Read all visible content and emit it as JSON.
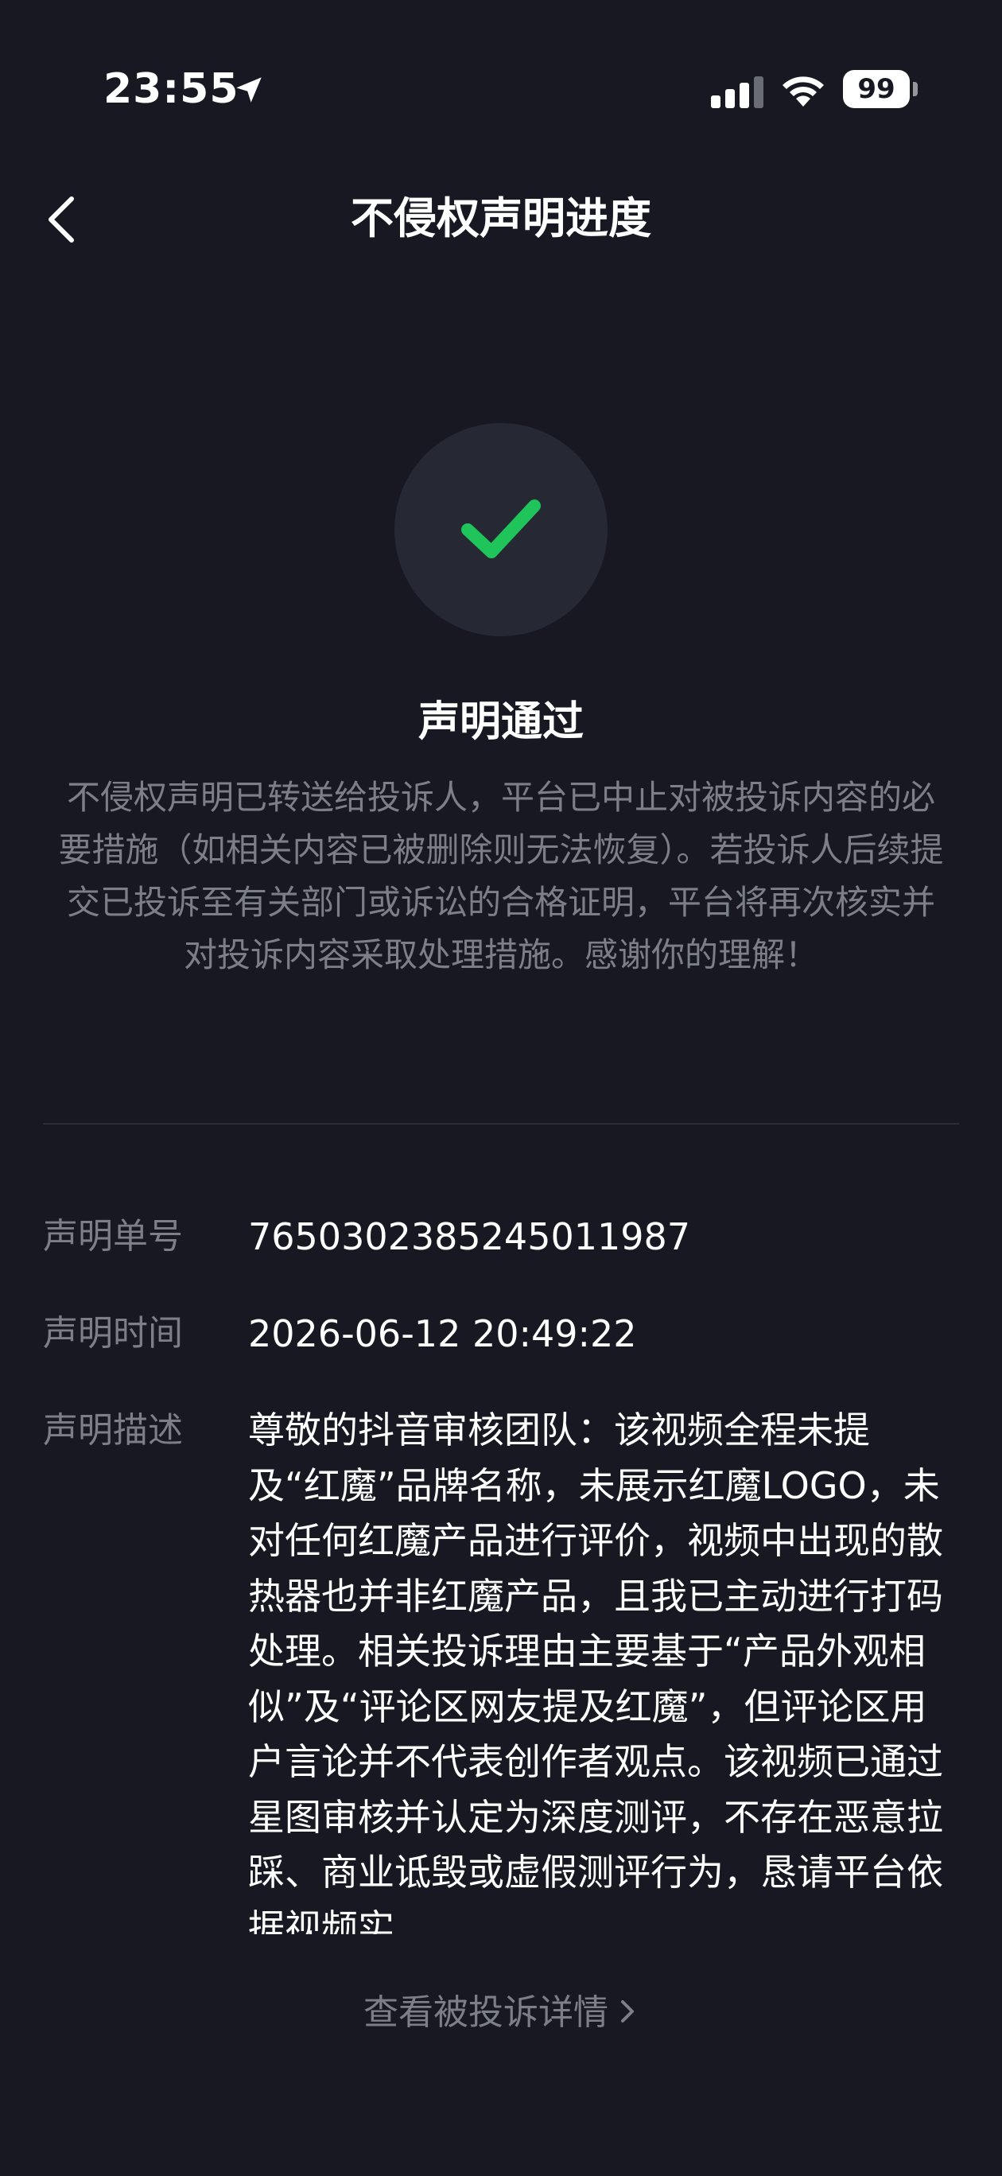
{
  "status_bar": {
    "time": "23:55",
    "battery": "99",
    "icons": [
      "location-arrow-icon",
      "cellular-signal-icon",
      "wifi-icon",
      "battery-icon"
    ]
  },
  "nav": {
    "title": "不侵权声明进度",
    "back_icon": "chevron-left-icon"
  },
  "result": {
    "icon": "check-icon",
    "icon_color": "#1fc45a",
    "title": "声明通过",
    "description": "不侵权声明已转送给投诉人，平台已中止对被投诉内容的必要措施（如相关内容已被删除则无法恢复）。若投诉人后续提交已投诉至有关部门或诉讼的合格证明，平台将再次核实并对投诉内容采取处理措施。感谢你的理解！"
  },
  "details": {
    "id_label": "声明单号",
    "id_value": "7650302385245011987",
    "time_label": "声明时间",
    "time_value": "2026-06-12 20:49:22",
    "desc_label": "声明描述",
    "desc_value": "尊敬的抖音审核团队：该视频全程未提及“红魔”品牌名称，未展示红魔LOGO，未对任何红魔产品进行评价，视频中出现的散热器也并非红魔产品，且我已主动进行打码处理。相关投诉理由主要基于“产品外观相似”及“评论区网友提及红魔”，但评论区用户言论并不代表创作者观点。该视频已通过星图审核并认定为深度测评，不存在恶意拉踩、商业诋毁或虚假测评行为，恳请平台依据视频实"
  },
  "footer": {
    "link_label": "查看被投诉详情",
    "link_icon": "chevron-right-icon"
  },
  "colors": {
    "background": "#171822",
    "secondary_text": "#7c7e88",
    "accent_green": "#1fc45a"
  }
}
